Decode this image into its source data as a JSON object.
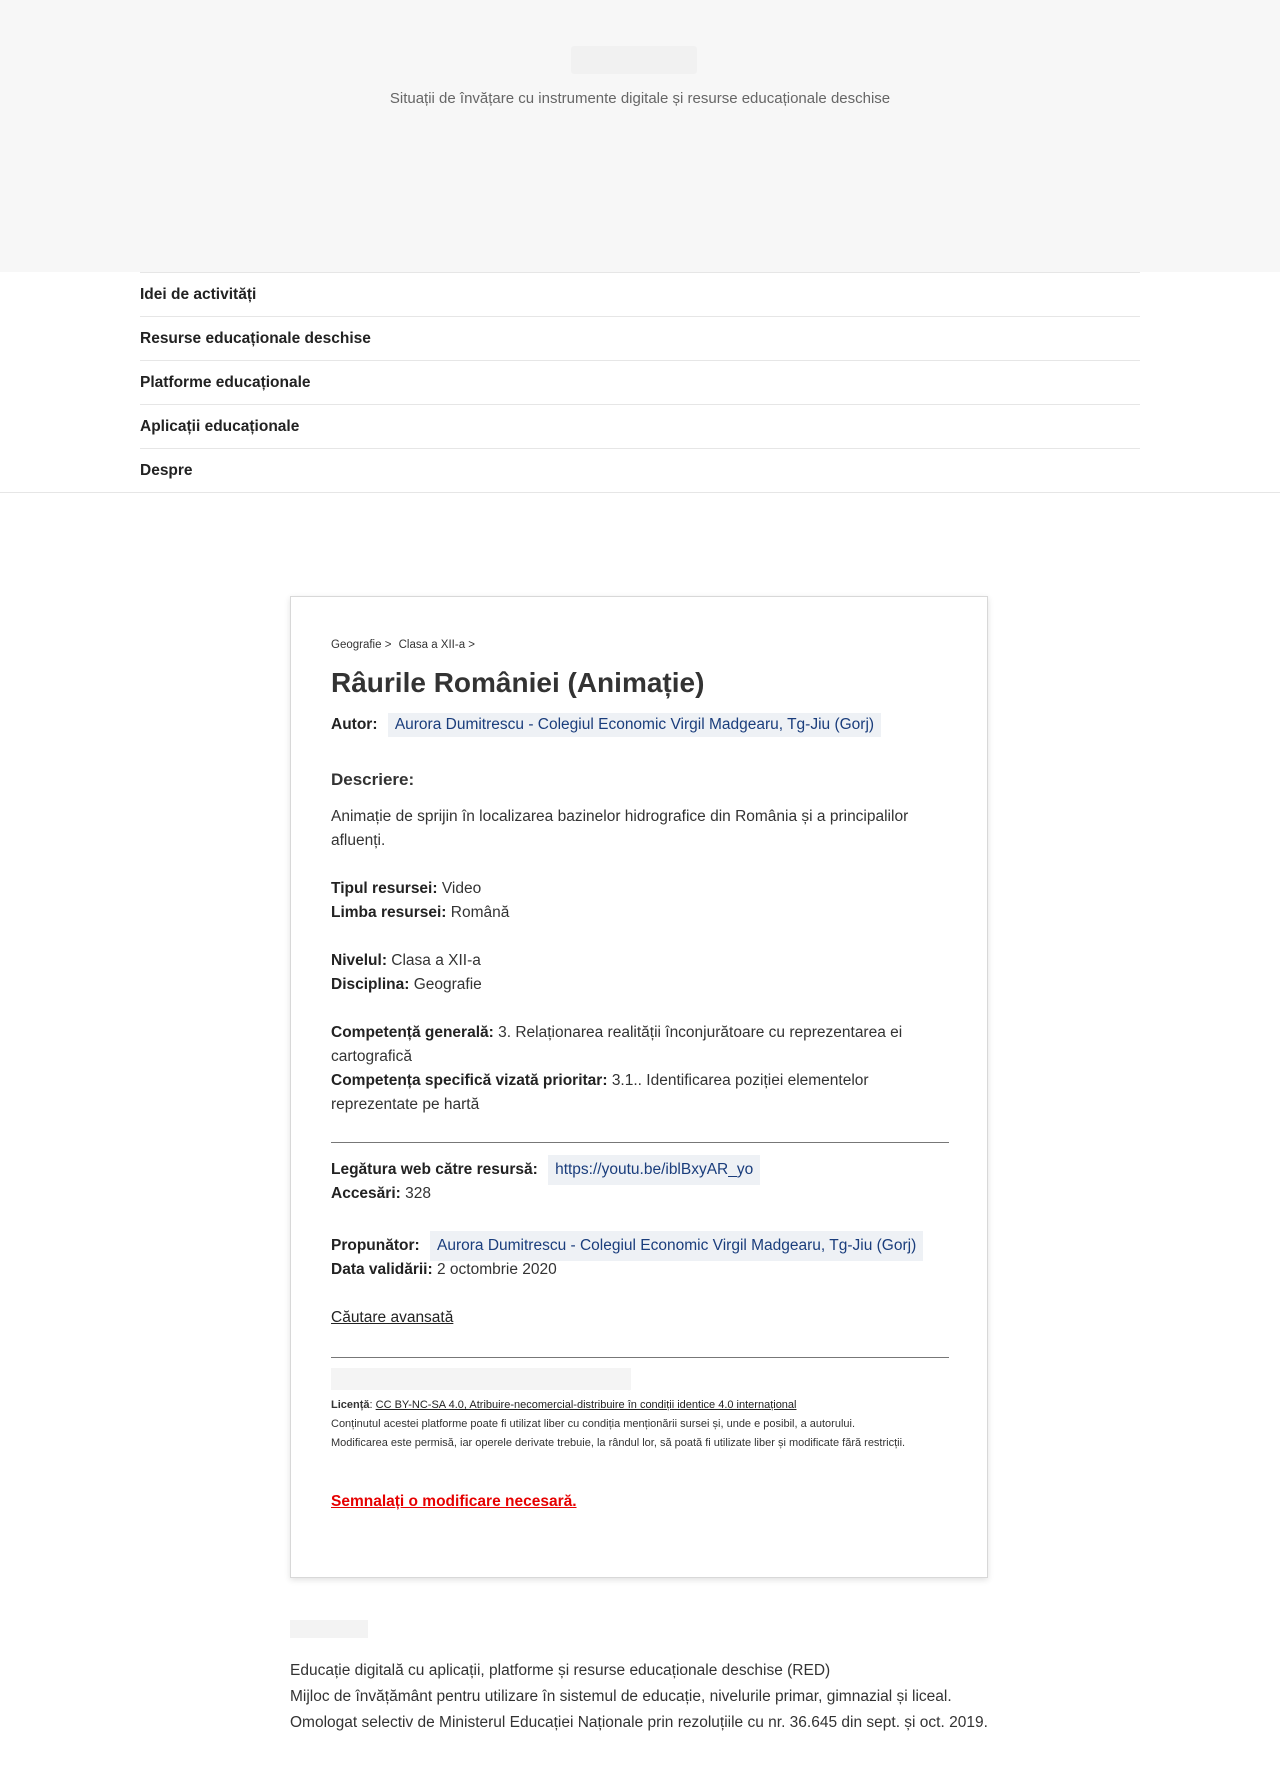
{
  "header": {
    "tagline": "Situații de învățare cu instrumente digitale și resurse educaționale deschise"
  },
  "nav": {
    "items": [
      {
        "label": "Idei de activități"
      },
      {
        "label": "Resurse educaționale deschise"
      },
      {
        "label": "Platforme educaționale"
      },
      {
        "label": "Aplicații educaționale"
      },
      {
        "label": "Despre"
      }
    ]
  },
  "breadcrumb": {
    "items": [
      "Geografie >",
      "Clasa a XII-a >"
    ]
  },
  "resource": {
    "title": "Râurile României (Animație)",
    "author_label": "Autor:",
    "author": "Aurora Dumitrescu - Colegiul Economic Virgil Madgearu, Tg-Jiu (Gorj)",
    "description_heading": "Descriere:",
    "description": "Animație de sprijin în localizarea bazinelor hidrografice din România și a principalilor afluenți.",
    "type_label": "Tipul resursei:",
    "type": "Video",
    "language_label": "Limba resursei:",
    "language": "Română",
    "level_label": "Nivelul:",
    "level": "Clasa a XII-a",
    "discipline_label": "Disciplina:",
    "discipline": "Geografie",
    "general_competence_label": "Competență generală:",
    "general_competence": "3. Relaționarea realității înconjurătoare cu reprezentarea ei cartografică",
    "specific_competence_label": "Competența specifică vizată prioritar:",
    "specific_competence": "3.1.. Identificarea poziției elementelor reprezentate pe hartă",
    "web_link_label": "Legătura web către resursă:",
    "web_link": "https://youtu.be/iblBxyAR_yo",
    "accesses_label": "Accesări:",
    "accesses": "328",
    "proposer_label": "Propunător:",
    "proposer": "Aurora Dumitrescu - Colegiul Economic Virgil Madgearu, Tg-Jiu (Gorj)",
    "validation_date_label": "Data validării:",
    "validation_date": "2 octombrie 2020",
    "advanced_search": "Căutare avansată"
  },
  "license": {
    "label": "Licență",
    "link_text": "CC BY-NC-SA 4.0, Atribuire-necomercial-distribuire în condiții identice 4.0 internațional",
    "line1": "Conținutul acestei platforme poate fi utilizat liber cu condiția menționării sursei și, unde e posibil, a autorului.",
    "line2": "Modificarea este permisă, iar operele derivate trebuie, la rândul lor, să poată fi utilizate liber și modificate fără restricții."
  },
  "report_link": "Semnalați o modificare necesară.",
  "footer": {
    "line1": "Educație digitală cu aplicații, platforme și resurse educaționale deschise (RED)",
    "line2": "Mijloc de învățământ pentru utilizare în sistemul de educație, nivelurile primar, gimnazial și liceal.",
    "line3": "Omologat selectiv de Ministerul Educației Naționale prin rezoluțiile cu nr. 36.645 din sept. și oct. 2019."
  }
}
